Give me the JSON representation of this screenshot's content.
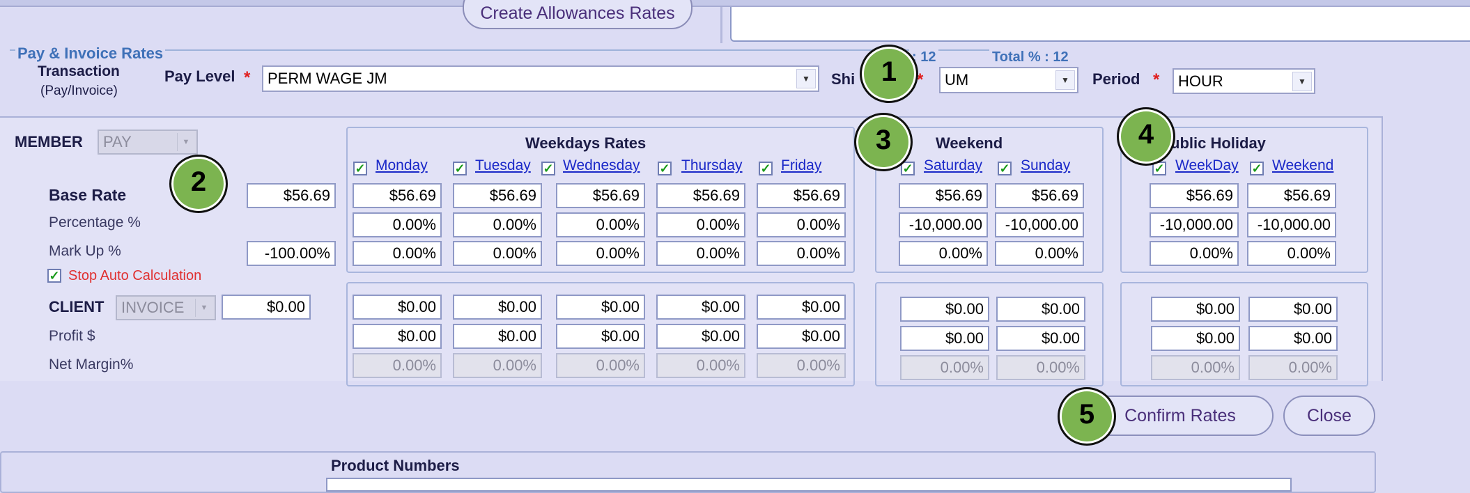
{
  "top": {
    "create_allowances_label": "Create Allowances Rates"
  },
  "section": {
    "title": "Pay & Invoice Rates",
    "total_pct_1": ": 12",
    "total_pct_2": "Total % : 12"
  },
  "header": {
    "transaction_label": "Transaction",
    "transaction_sub": "(Pay/Invoice)",
    "pay_level_label": "Pay Level",
    "pay_level_value": "PERM WAGE JM",
    "shift_label": "Shi",
    "shift_value": "UM",
    "period_label": "Period",
    "period_value": "HOUR",
    "required_mark": "*"
  },
  "member": {
    "label": "MEMBER",
    "type_value": "PAY",
    "base_rate_label": "Base Rate",
    "base_rate_value": "$56.69",
    "percentage_label": "Percentage %",
    "markup_label": "Mark Up %",
    "markup_value": "-100.00%",
    "stop_auto_label": "Stop Auto Calculation"
  },
  "client": {
    "label": "CLIENT",
    "type_value": "INVOICE",
    "value": "$0.00",
    "profit_label": "Profit $",
    "net_margin_label": "Net Margin%"
  },
  "weekdays": {
    "title": "Weekdays Rates",
    "days": [
      "Monday",
      "Tuesday",
      "Wednesday",
      "Thursday",
      "Friday"
    ],
    "base": [
      "$56.69",
      "$56.69",
      "$56.69",
      "$56.69",
      "$56.69"
    ],
    "percentage": [
      "0.00%",
      "0.00%",
      "0.00%",
      "0.00%",
      "0.00%"
    ],
    "markup": [
      "0.00%",
      "0.00%",
      "0.00%",
      "0.00%",
      "0.00%"
    ],
    "client": [
      "$0.00",
      "$0.00",
      "$0.00",
      "$0.00",
      "$0.00"
    ],
    "profit": [
      "$0.00",
      "$0.00",
      "$0.00",
      "$0.00",
      "$0.00"
    ],
    "margin": [
      "0.00%",
      "0.00%",
      "0.00%",
      "0.00%",
      "0.00%"
    ]
  },
  "weekend": {
    "title": "Weekend",
    "days": [
      "Saturday",
      "Sunday"
    ],
    "base": [
      "$56.69",
      "$56.69"
    ],
    "percentage": [
      "-10,000.00",
      "-10,000.00"
    ],
    "markup": [
      "0.00%",
      "0.00%"
    ],
    "client": [
      "$0.00",
      "$0.00"
    ],
    "profit": [
      "$0.00",
      "$0.00"
    ],
    "margin": [
      "0.00%",
      "0.00%"
    ]
  },
  "holiday": {
    "title": "ublic Holiday",
    "days": [
      "WeekDay",
      "Weekend"
    ],
    "base": [
      "$56.69",
      "$56.69"
    ],
    "percentage": [
      "-10,000.00",
      "-10,000.00"
    ],
    "markup": [
      "0.00%",
      "0.00%"
    ],
    "client": [
      "$0.00",
      "$0.00"
    ],
    "profit": [
      "$0.00",
      "$0.00"
    ],
    "margin": [
      "0.00%",
      "0.00%"
    ]
  },
  "callouts": [
    "1",
    "2",
    "3",
    "4",
    "5"
  ],
  "actions": {
    "confirm_label": "Confirm Rates",
    "close_label": "Close"
  },
  "product": {
    "label": "Product Numbers"
  },
  "colors": {
    "background": "#dcdcf4",
    "accent_blue": "#3f71b8",
    "callout_green": "#7cb450",
    "required_red": "#e02020"
  }
}
